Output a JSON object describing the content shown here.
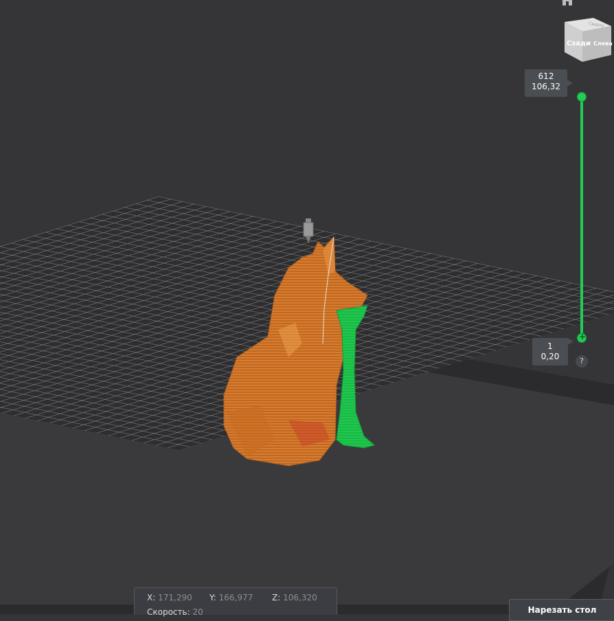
{
  "colors": {
    "background": "#353537",
    "bed_grid": "#8c8c8c",
    "model_orange": "#d9792b",
    "support_green": "#22cc55",
    "slider_green": "#22cc55",
    "label_bg": "#4a4d52"
  },
  "view_cube": {
    "face_front": "Сзади",
    "face_side": "Слева",
    "face_top": "Сверху"
  },
  "layer_slider": {
    "top_layer": "612",
    "top_height": "106,32",
    "bottom_layer": "1",
    "bottom_height": "0,20",
    "help_label": "?"
  },
  "icons": {
    "home": "home-icon",
    "nozzle": "nozzle-icon",
    "help": "help-icon"
  },
  "status": {
    "x_label": "X:",
    "x_value": "171,290",
    "y_label": "Y:",
    "y_value": "166,977",
    "z_label": "Z:",
    "z_value": "106,320",
    "speed_label": "Скорость:",
    "speed_value": "20"
  },
  "slice_button_label": "Нарезать стол"
}
